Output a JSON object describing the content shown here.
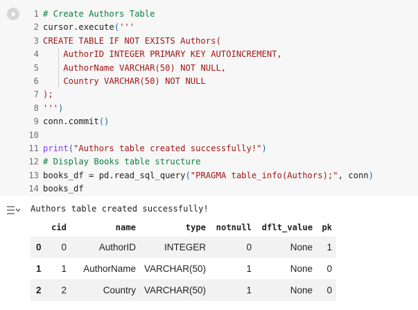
{
  "code_cell": {
    "lines": [
      {
        "n": "1",
        "parts": [
          {
            "t": "# Create Authors Table",
            "c": "t-comment"
          }
        ]
      },
      {
        "n": "2",
        "parts": [
          {
            "t": "cursor.execute",
            "c": ""
          },
          {
            "t": "(",
            "c": "t-paren"
          },
          {
            "t": "'''",
            "c": "t-string"
          }
        ]
      },
      {
        "n": "3",
        "parts": [
          {
            "t": "CREATE TABLE IF NOT EXISTS Authors(",
            "c": "t-string"
          }
        ]
      },
      {
        "n": "4",
        "guide": true,
        "parts": [
          {
            "t": "    AuthorID INTEGER PRIMARY KEY AUTOINCREMENT,",
            "c": "t-string"
          }
        ]
      },
      {
        "n": "5",
        "guide": true,
        "parts": [
          {
            "t": "    AuthorName VARCHAR(50) NOT NULL,",
            "c": "t-string"
          }
        ]
      },
      {
        "n": "6",
        "guide": true,
        "parts": [
          {
            "t": "    Country VARCHAR(50) NOT NULL",
            "c": "t-string"
          }
        ]
      },
      {
        "n": "7",
        "parts": [
          {
            "t": ");",
            "c": "t-string"
          }
        ]
      },
      {
        "n": "8",
        "parts": [
          {
            "t": "'''",
            "c": "t-string"
          },
          {
            "t": ")",
            "c": "t-paren"
          }
        ]
      },
      {
        "n": "9",
        "parts": [
          {
            "t": "conn.commit",
            "c": ""
          },
          {
            "t": "()",
            "c": "t-paren"
          }
        ]
      },
      {
        "n": "10",
        "parts": [
          {
            "t": "",
            "c": ""
          }
        ]
      },
      {
        "n": "11",
        "parts": [
          {
            "t": "print",
            "c": "t-func"
          },
          {
            "t": "(",
            "c": "t-paren"
          },
          {
            "t": "\"Authors table created successfully!\"",
            "c": "t-string"
          },
          {
            "t": ")",
            "c": "t-paren"
          }
        ]
      },
      {
        "n": "12",
        "parts": [
          {
            "t": "# Display Books table structure",
            "c": "t-comment"
          }
        ]
      },
      {
        "n": "13",
        "parts": [
          {
            "t": "books_df = pd.read_sql_query",
            "c": ""
          },
          {
            "t": "(",
            "c": "t-paren"
          },
          {
            "t": "\"PRAGMA table_info(Authors);\"",
            "c": "t-string"
          },
          {
            "t": ", conn",
            "c": ""
          },
          {
            "t": ")",
            "c": "t-paren"
          }
        ]
      },
      {
        "n": "14",
        "parts": [
          {
            "t": "books_df",
            "c": ""
          }
        ]
      }
    ]
  },
  "output": {
    "stdout": "Authors table created successfully!",
    "table": {
      "columns": [
        "",
        "cid",
        "name",
        "type",
        "notnull",
        "dflt_value",
        "pk"
      ],
      "rows": [
        [
          "0",
          "0",
          "AuthorID",
          "INTEGER",
          "0",
          "None",
          "1"
        ],
        [
          "1",
          "1",
          "AuthorName",
          "VARCHAR(50)",
          "1",
          "None",
          "0"
        ],
        [
          "2",
          "2",
          "Country",
          "VARCHAR(50)",
          "1",
          "None",
          "0"
        ]
      ]
    }
  },
  "colors": {
    "comment": "#0b8043",
    "string": "#a31515",
    "paren": "#1a5fb4",
    "function": "#7c3aed"
  }
}
